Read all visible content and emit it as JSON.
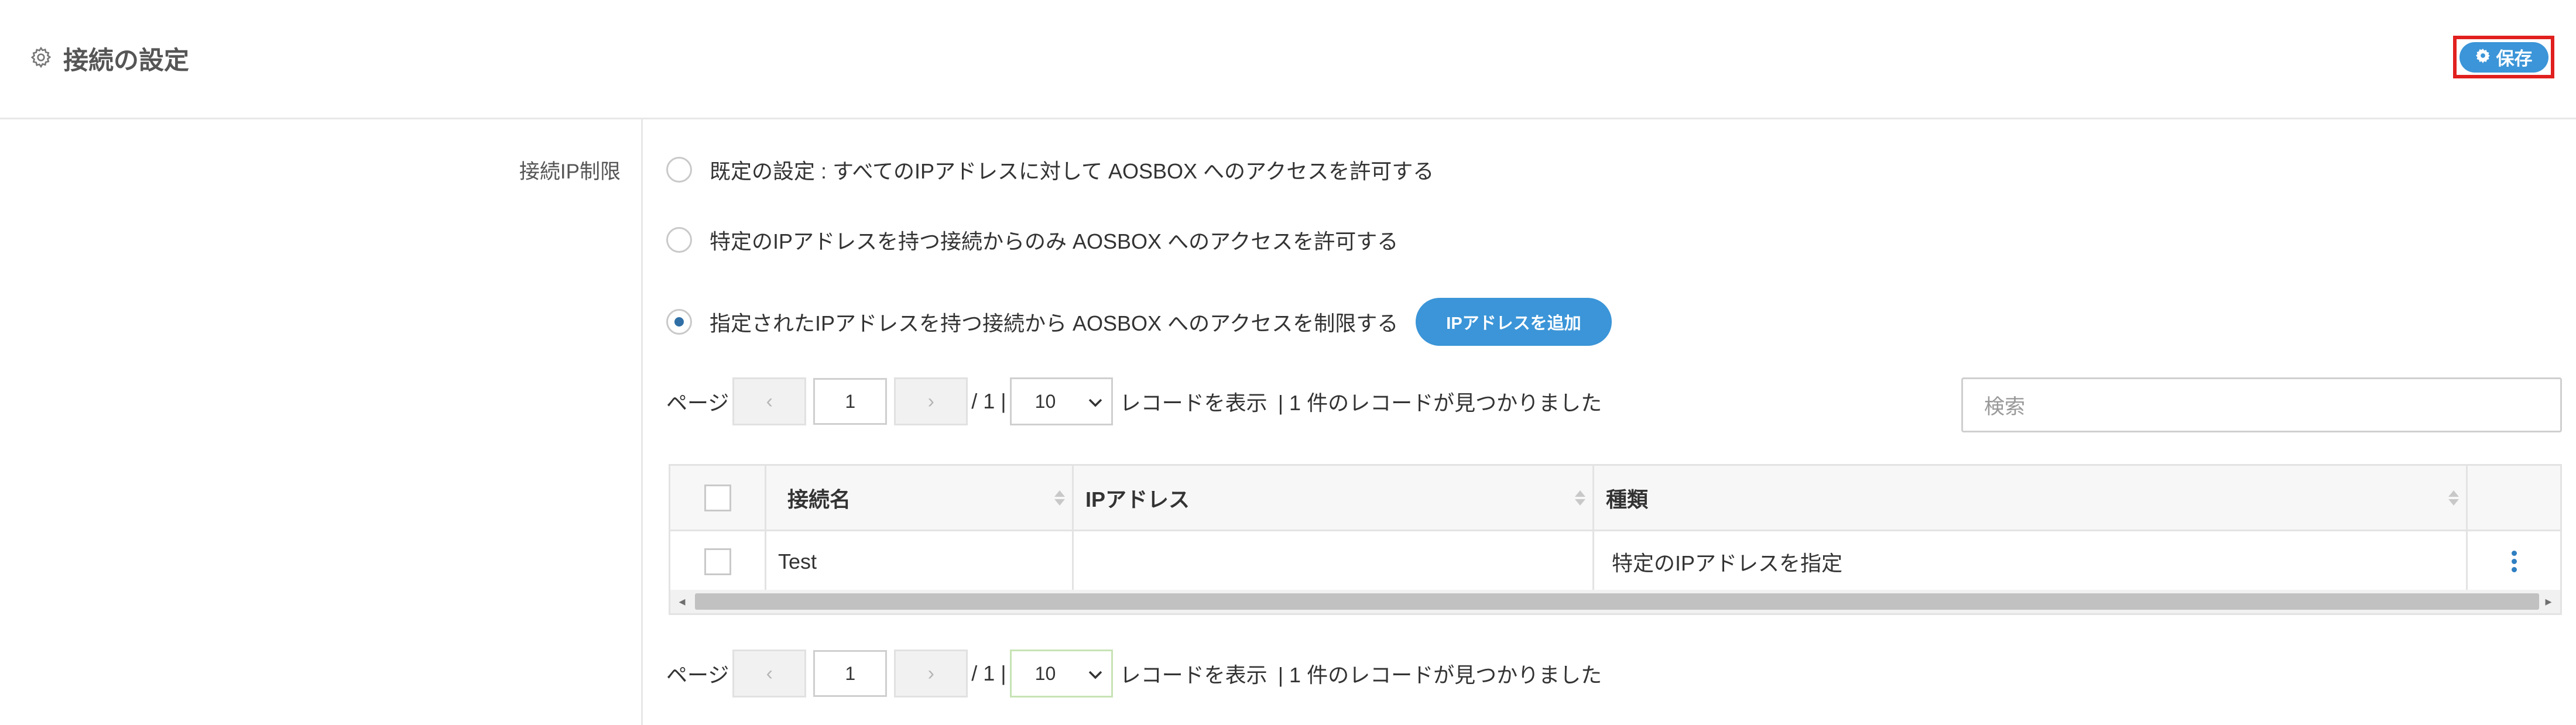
{
  "header": {
    "title": "接続の設定",
    "save_label": "保存"
  },
  "form": {
    "field_label": "接続IP制限",
    "options": [
      {
        "label": "既定の設定 : すべてのIPアドレスに対して AOSBOX へのアクセスを許可する",
        "selected": false
      },
      {
        "label": "特定のIPアドレスを持つ接続からのみ AOSBOX へのアクセスを許可する",
        "selected": false
      },
      {
        "label": "指定されたIPアドレスを持つ接続から AOSBOX へのアクセスを制限する",
        "selected": true
      }
    ],
    "add_ip_label": "IPアドレスを追加"
  },
  "pager": {
    "page_label": "ページ",
    "prev": "‹",
    "next": "›",
    "current_page": "1",
    "total": "/ 1 |",
    "per_page": "10",
    "records_label": "レコードを表示",
    "found_text": "| 1 件のレコードが見つかりました"
  },
  "search": {
    "placeholder": "検索"
  },
  "table": {
    "columns": [
      "接続名",
      "IPアドレス",
      "種類"
    ],
    "rows": [
      {
        "name": "Test",
        "ip": "",
        "type": "特定のIPアドレスを指定"
      }
    ]
  },
  "colors": {
    "primary": "#3b95d8",
    "highlight_border": "#e0201e",
    "selected_radio": "#2f6fa6"
  },
  "icons": {
    "title_icon": "gear-outline-icon",
    "save_icon": "gear-icon",
    "row_menu": "kebab-menu-icon"
  }
}
